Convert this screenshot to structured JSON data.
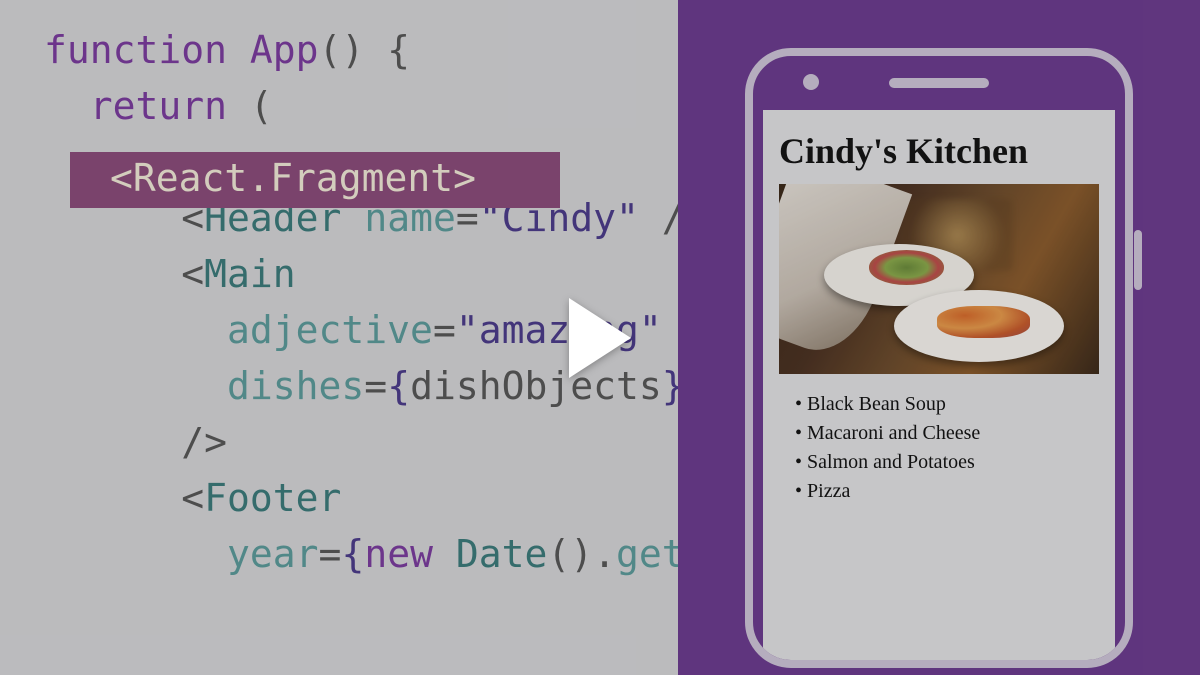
{
  "code": {
    "l1_a": "function",
    "l1_b": " App",
    "l1_c": "() {",
    "l2_a": "  return",
    "l2_b": " (",
    "l3": "<React.Fragment>",
    "l4_a": "      <",
    "l4_b": "Header",
    "l4_c": " name",
    "l4_d": "=",
    "l4_e": "\"Cindy\"",
    "l4_f": " /",
    "l5_a": "      <",
    "l5_b": "Main",
    "l6_a": "        adjective",
    "l6_b": "=",
    "l6_c": "\"amazing\"",
    "l7_a": "        dishes",
    "l7_b": "=",
    "l7_c": "{",
    "l7_d": "dishObjects",
    "l7_e": "}",
    "l8": "      />",
    "l9_a": "      <",
    "l9_b": "Footer",
    "l10_a": "        year",
    "l10_b": "=",
    "l10_c": "{",
    "l10_d": "new",
    "l10_e": " Date",
    "l10_f": "().",
    "l10_g": "get"
  },
  "app": {
    "title": "Cindy's Kitchen",
    "dishes": [
      "Black Bean Soup",
      "Macaroni and Cheese",
      "Salmon and Potatoes",
      "Pizza"
    ]
  },
  "colors": {
    "purple": "#6b3a8e",
    "highlight": "#8a4a7a",
    "code_bg": "#d5d5d8"
  }
}
